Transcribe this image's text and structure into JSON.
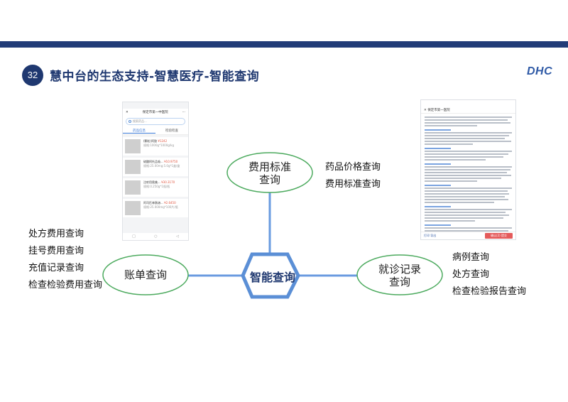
{
  "header": {
    "slide_number": "32",
    "title": "慧中台的生态支持-智慧医疗-智能查询",
    "logo_text": "DHC",
    "band_color": "#223c78"
  },
  "hub": {
    "label": "智能查询",
    "border_color": "#5b8fd6"
  },
  "nodes": {
    "fee_standard": {
      "label_lines": [
        "费用标准",
        "查询"
      ],
      "items": [
        "药品价格查询",
        "费用标准查询"
      ]
    },
    "bill": {
      "label": "账单查询",
      "items": [
        "处方费用查询",
        "挂号费用查询",
        "充值记录查询",
        "检查检验费用查询"
      ]
    },
    "visit_record": {
      "label_lines": [
        "就诊记录",
        "查询"
      ],
      "items": [
        "病例查询",
        "处方查询",
        "检查检验报告查询"
      ]
    },
    "ellipse_border_color": "#4caa5e"
  },
  "phone_screen": {
    "title": "保定市第一中医院",
    "search_placeholder": "搜索药品...",
    "tabs": [
      "药品信息",
      "检验检查"
    ],
    "items": [
      {
        "name": "(颗粒)阿胶",
        "price": "¥1242",
        "sub": "规格:1000g*1000g/kg"
      },
      {
        "name": "硫酸阿托品吸...",
        "price": "¥10.9750",
        "sub": "规格:25.00mg:5.0g*1盒/盒"
      },
      {
        "name": "注射用奥美...",
        "price": "¥30.3170",
        "sub": "规格:0.250g*1瓶/瓶"
      },
      {
        "name": "阿司匹林肠溶...",
        "price": "¥2.6450",
        "sub": "规格:25.000mg*100片/瓶"
      }
    ]
  },
  "document_screen": {
    "title": "保定市第一医院",
    "footer_left": "打印 导出",
    "footer_button": "确认(2) 提交"
  }
}
